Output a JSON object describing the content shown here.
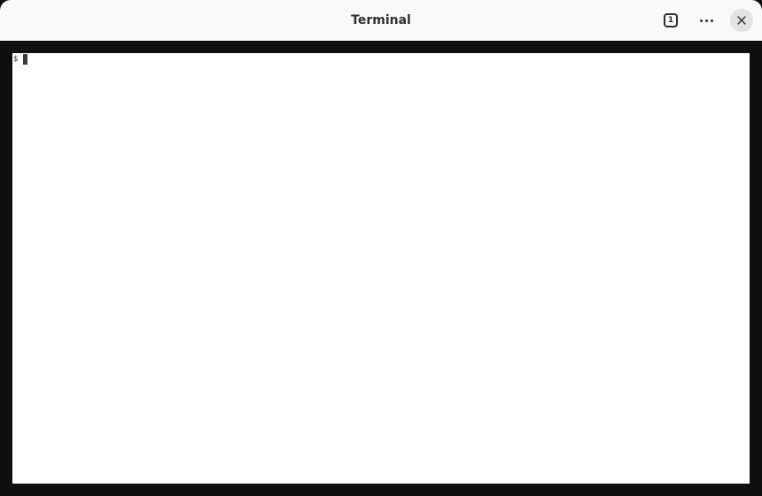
{
  "window": {
    "title": "Terminal"
  },
  "header": {
    "tab_count": "1",
    "menu_icon": "more-horizontal-icon",
    "close_icon": "close-icon"
  },
  "terminal": {
    "prompt": "$",
    "background_color": "#ffffff",
    "frame_color": "#0f0f12"
  }
}
